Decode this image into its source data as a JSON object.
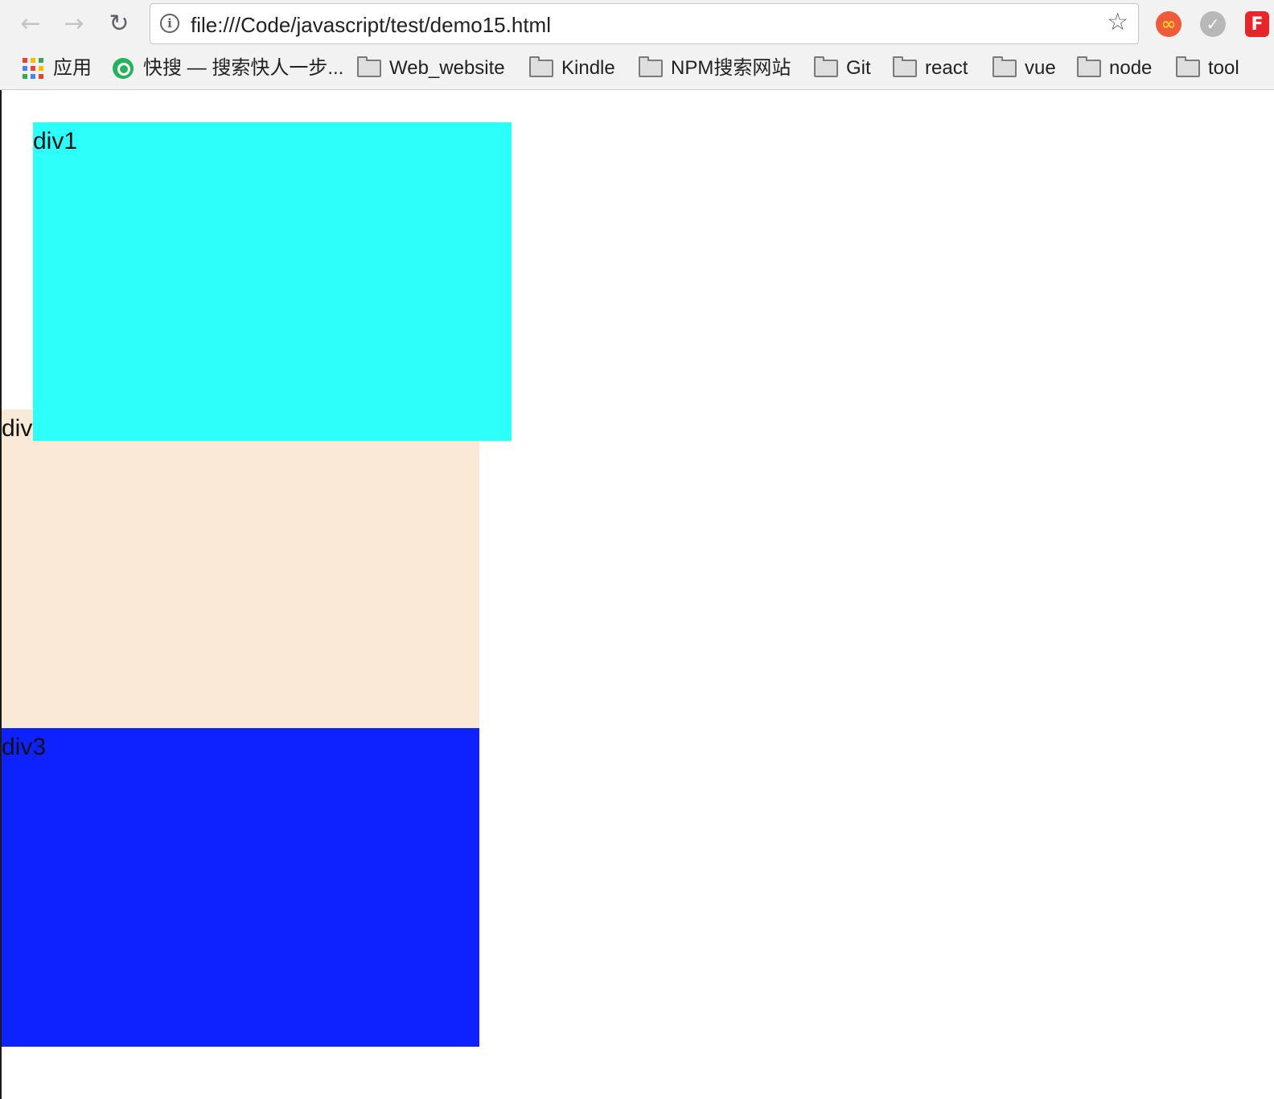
{
  "browser": {
    "url": "file:///Code/javascript/test/demo15.html",
    "back_icon": "arrow-left-icon",
    "forward_icon": "arrow-right-icon",
    "reload_icon": "reload-icon",
    "info_icon": "info-icon",
    "star_icon": "star-icon",
    "extensions": [
      {
        "name": "infinity-extension-icon",
        "color": "#ef5a3a"
      },
      {
        "name": "check-extension-icon",
        "color": "#b8b8b8"
      },
      {
        "name": "f-extension-icon",
        "color": "#e8262a"
      }
    ],
    "bookmarks": [
      {
        "label": "应用",
        "icon": "apps-grid-icon"
      },
      {
        "label": "快搜 — 搜索快人一步...",
        "icon": "kuaisou-icon"
      },
      {
        "label": "Web_website",
        "icon": "folder-icon"
      },
      {
        "label": "Kindle",
        "icon": "folder-icon"
      },
      {
        "label": "NPM搜索网站",
        "icon": "folder-icon"
      },
      {
        "label": "Git",
        "icon": "folder-icon"
      },
      {
        "label": "react",
        "icon": "folder-icon"
      },
      {
        "label": "vue",
        "icon": "folder-icon"
      },
      {
        "label": "node",
        "icon": "folder-icon"
      },
      {
        "label": "tool",
        "icon": "folder-icon"
      }
    ]
  },
  "page": {
    "div1": {
      "label": "div1",
      "color": "#2dfffb"
    },
    "div2": {
      "label": "div2",
      "color": "#fae9d7"
    },
    "div3": {
      "label": "div3",
      "color": "#0d22ff"
    }
  }
}
